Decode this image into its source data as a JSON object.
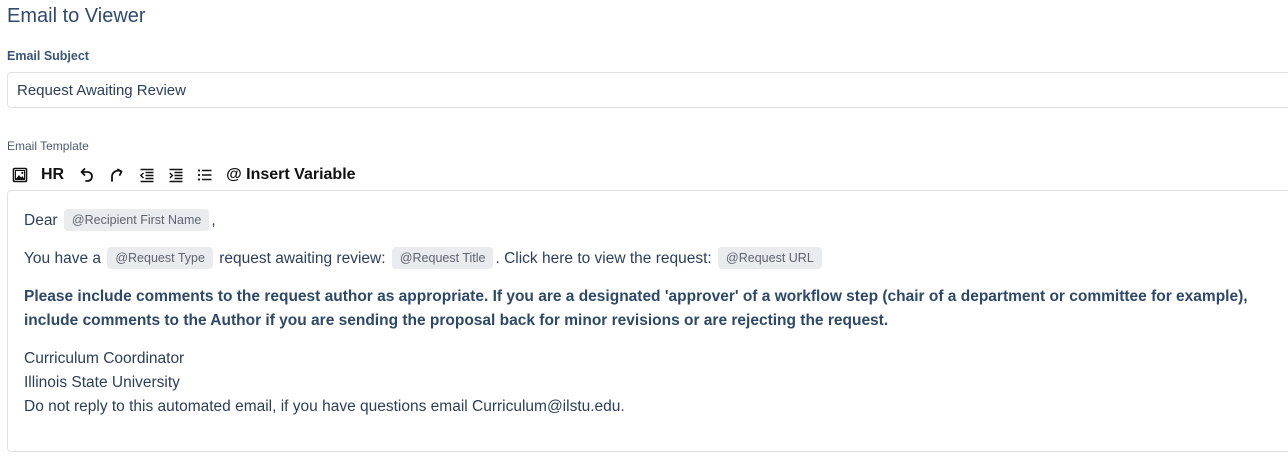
{
  "section": {
    "title": "Email to Viewer"
  },
  "subject": {
    "label": "Email Subject",
    "value": "Request Awaiting Review"
  },
  "template": {
    "label": "Email Template",
    "toolbar": {
      "image_icon": "image-icon",
      "hr_label": "HR",
      "undo_icon": "undo-icon",
      "redo_icon": "redo-icon",
      "outdent_icon": "outdent-icon",
      "indent_icon": "indent-icon",
      "list_icon": "bullet-list-icon",
      "insert_variable_label": "@ Insert Variable"
    },
    "body": {
      "greeting_prefix": "Dear",
      "greeting_var": "@Recipient First Name",
      "greeting_suffix": ",",
      "line2_part1": "You have a",
      "line2_var1": "@Request Type",
      "line2_part2": "request awaiting review:",
      "line2_var2": "@Request Title",
      "line2_part3": ". Click here to view the request:",
      "line2_var3": "@Request URL",
      "bold_paragraph": "Please include comments to the request author as appropriate. If you are a designated 'approver' of a workflow step (chair of a department or committee for example), include comments to the Author if you are sending the proposal back for minor revisions or are rejecting the request.",
      "signature_line1": "Curriculum Coordinator",
      "signature_line2": "Illinois State University",
      "signature_line3": "Do not reply to this automated email, if you have questions email Curriculum@ilstu.edu."
    }
  }
}
